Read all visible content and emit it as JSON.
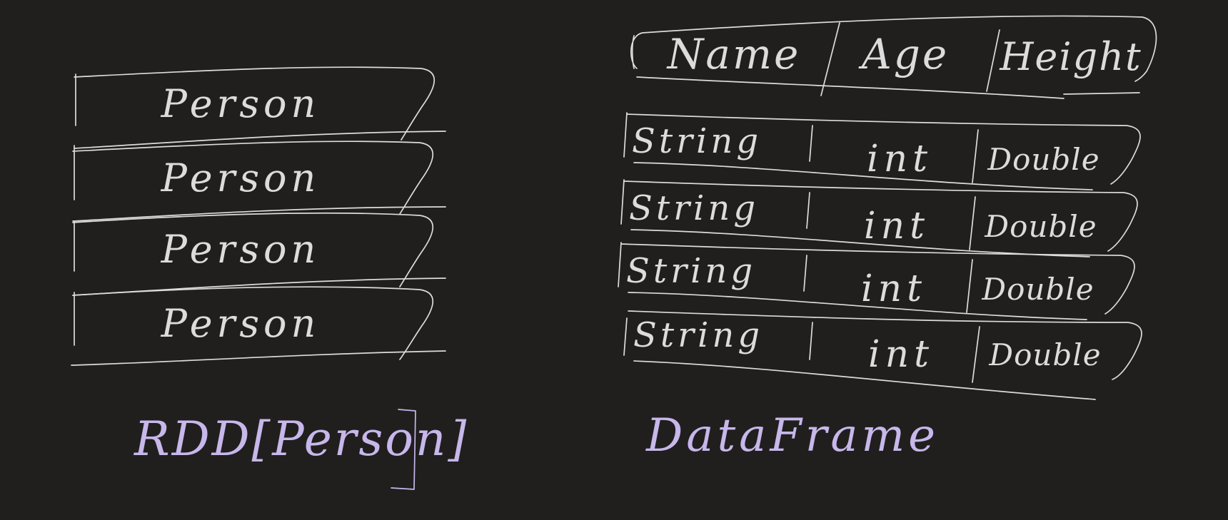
{
  "colors": {
    "background": "#201f1e",
    "ink": "#dcdcdc",
    "caption_ink": "#c7b7ea"
  },
  "rdd": {
    "rows": [
      {
        "label": "Person"
      },
      {
        "label": "Person"
      },
      {
        "label": "Person"
      },
      {
        "label": "Person"
      }
    ],
    "caption": "RDD[Person]"
  },
  "dataframe": {
    "columns": [
      "Name",
      "Age",
      "Height"
    ],
    "rows": [
      [
        "String",
        "int",
        "Double"
      ],
      [
        "String",
        "int",
        "Double"
      ],
      [
        "String",
        "int",
        "Double"
      ],
      [
        "String",
        "int",
        "Double"
      ]
    ],
    "caption": "DataFrame"
  }
}
